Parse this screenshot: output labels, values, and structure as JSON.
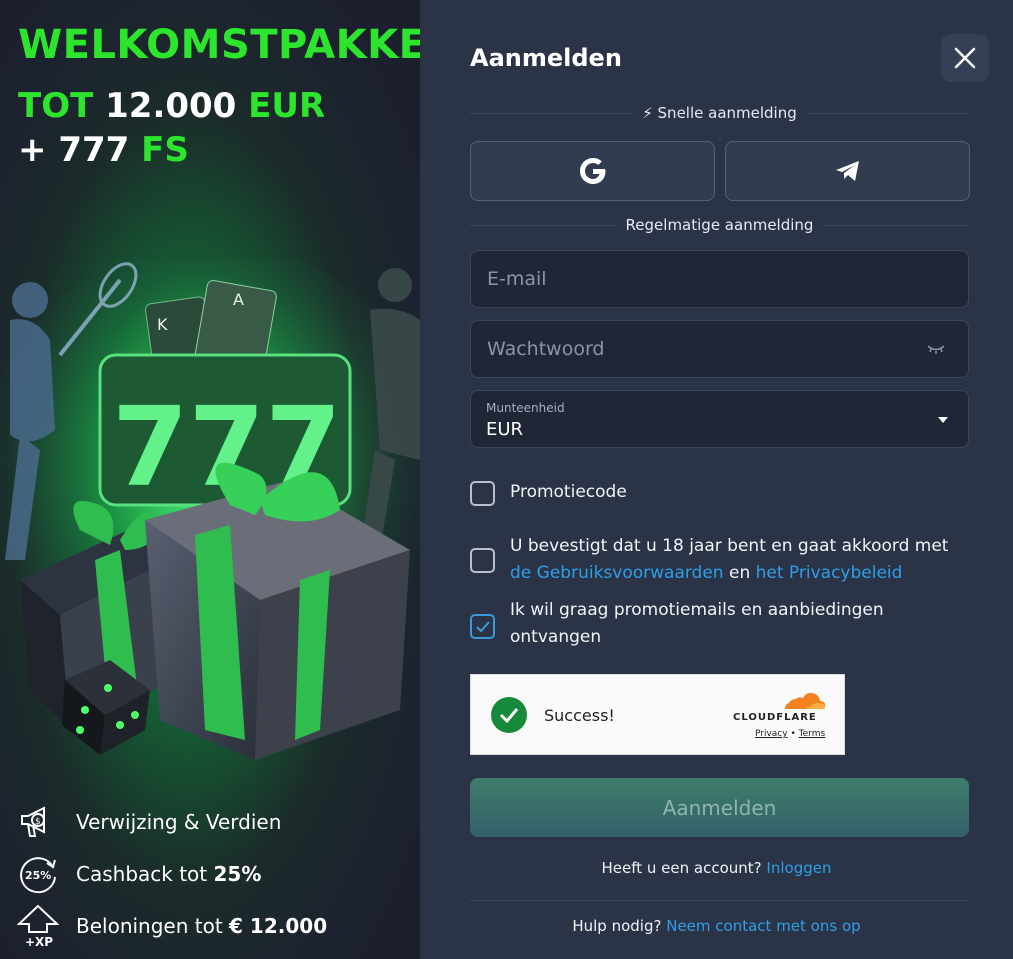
{
  "promo": {
    "title": "WELKOMSTPAKKET",
    "line2_prefix": "TOT ",
    "line2_amount": "12.000",
    "line2_suffix": " EUR",
    "line3_prefix": "+ 777 ",
    "line3_suffix": "FS",
    "perks": [
      {
        "icon": "megaphone-dollar-icon",
        "label": "Verwijzing & Verdien",
        "bold": ""
      },
      {
        "icon": "cashback-25-icon",
        "icon_text": "25%",
        "label": "Cashback tot ",
        "bold": "25%"
      },
      {
        "icon": "xp-arrow-icon",
        "icon_text": "+XP",
        "label": "Beloningen tot ",
        "bold": "€ 12.000"
      }
    ]
  },
  "form": {
    "title": "Aanmelden",
    "quick_label": "⚡ Snelle aanmelding",
    "regular_label": "Regelmatige aanmelding",
    "email_placeholder": "E-mail",
    "password_placeholder": "Wachtwoord",
    "currency_label": "Munteenheid",
    "currency_value": "EUR",
    "promo_code_label": "Promotiecode",
    "terms_text_1": "U bevestigt dat u 18 jaar bent en gaat akkoord met",
    "terms_link_1": "de Gebruiksvoorwaarden",
    "terms_and": " en ",
    "terms_link_2": "het Privacybeleid",
    "marketing_label": "Ik wil graag promotiemails en aanbiedingen ontvangen",
    "marketing_checked": true,
    "submit_label": "Aanmelden",
    "have_account": "Heeft u een account?",
    "login_link": "Inloggen",
    "help": "Hulp nodig?",
    "contact_link": "Neem contact met ons op"
  },
  "captcha": {
    "status": "Success!",
    "brand": "CLOUDFLARE",
    "privacy": "Privacy",
    "separator": "•",
    "terms": "Terms"
  },
  "colors": {
    "accent_green": "#2ee52e",
    "panel_bg": "#2b3447",
    "link": "#2f9ee8"
  }
}
